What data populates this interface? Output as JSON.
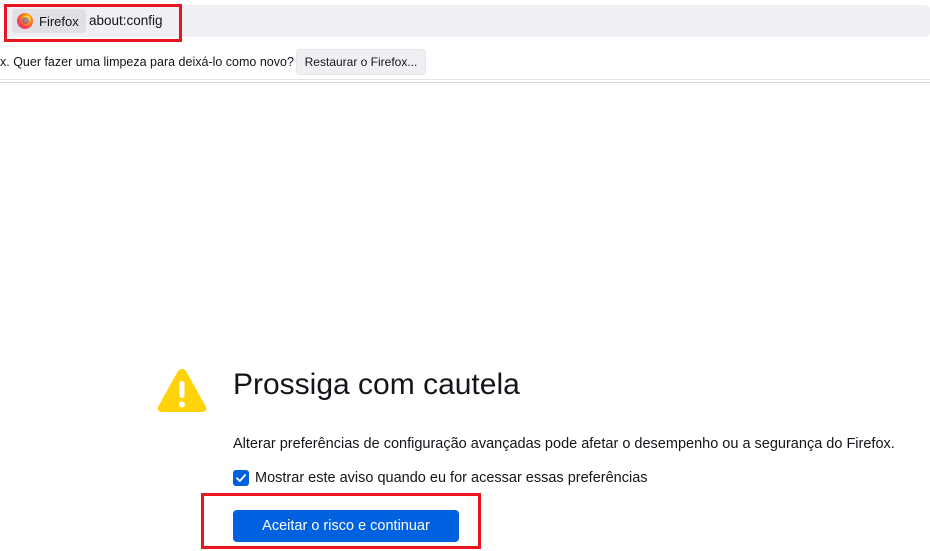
{
  "urlbar": {
    "identity_label": "Firefox",
    "url": "about:config",
    "highlight_color": "#e8141e"
  },
  "notification": {
    "message": "x. Quer fazer uma limpeza para deixá-lo como novo?",
    "button_label": "Restaurar o Firefox..."
  },
  "warning": {
    "icon": "warning-triangle-icon",
    "title": "Prossiga com cautela",
    "description": "Alterar preferências de configuração avançadas pode afetar o desempenho ou a segurança do Firefox.",
    "checkbox_label": "Mostrar este aviso quando eu for acessar essas preferências",
    "checkbox_checked": true,
    "accept_button_label": "Aceitar o risco e continuar"
  },
  "colors": {
    "accent": "#0061e0",
    "warning_yellow": "#ffd20a",
    "highlight": "#e8141e"
  }
}
